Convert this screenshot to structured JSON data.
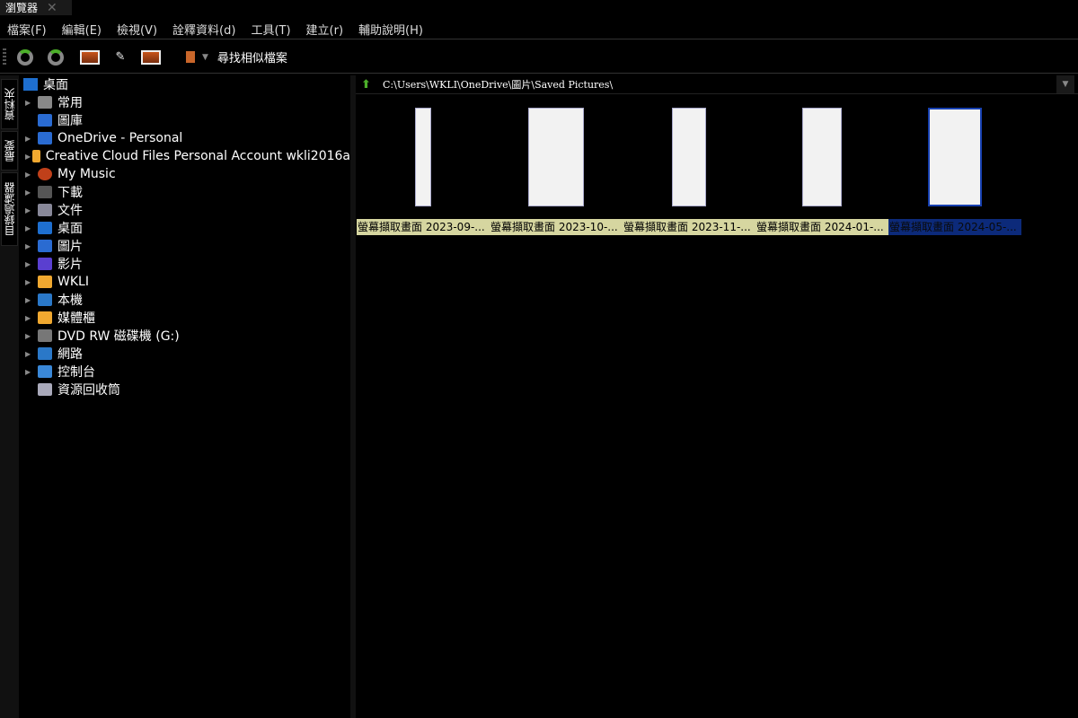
{
  "tab": {
    "title": "瀏覽器"
  },
  "menu": [
    "檔案(F)",
    "編輯(E)",
    "檢視(V)",
    "詮釋資料(d)",
    "工具(T)",
    "建立(r)",
    "輔助說明(H)"
  ],
  "toolbar": {
    "find_similar": "尋找相似檔案"
  },
  "side_tabs": [
    "資料夾",
    "最愛",
    "目錄過濾器"
  ],
  "tree": {
    "root": "桌面",
    "items": [
      {
        "label": "常用",
        "icon": "home-icon",
        "color": "#888"
      },
      {
        "label": "圖庫",
        "icon": "gallery-icon",
        "color": "#2a6bd1"
      },
      {
        "label": "OneDrive - Personal",
        "icon": "cloud-icon",
        "color": "#2a6bd1"
      },
      {
        "label": "Creative Cloud Files Personal Account wkli2016a",
        "icon": "folder-icon",
        "color": "#f0a830"
      },
      {
        "label": "My Music",
        "icon": "music-icon",
        "color": "#c0401a"
      },
      {
        "label": "下載",
        "icon": "download-icon",
        "color": "#555"
      },
      {
        "label": "文件",
        "icon": "document-icon",
        "color": "#889"
      },
      {
        "label": "桌面",
        "icon": "desktop-icon",
        "color": "#1e6fd0"
      },
      {
        "label": "圖片",
        "icon": "pictures-icon",
        "color": "#2a6bd1"
      },
      {
        "label": "影片",
        "icon": "video-icon",
        "color": "#5a3fd0"
      },
      {
        "label": "WKLI",
        "icon": "folder-icon",
        "color": "#f0a830"
      },
      {
        "label": "本機",
        "icon": "computer-icon",
        "color": "#2a78c8"
      },
      {
        "label": "媒體櫃",
        "icon": "folder-icon",
        "color": "#f0a830"
      },
      {
        "label": "DVD RW 磁碟機 (G:)",
        "icon": "dvd-drive-icon",
        "color": "#777"
      },
      {
        "label": "網路",
        "icon": "network-icon",
        "color": "#2a78c8"
      },
      {
        "label": "控制台",
        "icon": "control-panel-icon",
        "color": "#3a88d8"
      },
      {
        "label": "資源回收筒",
        "icon": "recycle-bin-icon",
        "color": "#aab"
      }
    ]
  },
  "address": {
    "path": "C:\\Users\\WKLI\\OneDrive\\圖片\\Saved Pictures\\"
  },
  "files": [
    {
      "name": "螢幕擷取畫面 2023-09-..."
    },
    {
      "name": "螢幕擷取畫面 2023-10-..."
    },
    {
      "name": "螢幕擷取畫面 2023-11-..."
    },
    {
      "name": "螢幕擷取畫面 2024-01-..."
    },
    {
      "name": "螢幕擷取畫面 2024-05-...",
      "selected": true
    }
  ]
}
